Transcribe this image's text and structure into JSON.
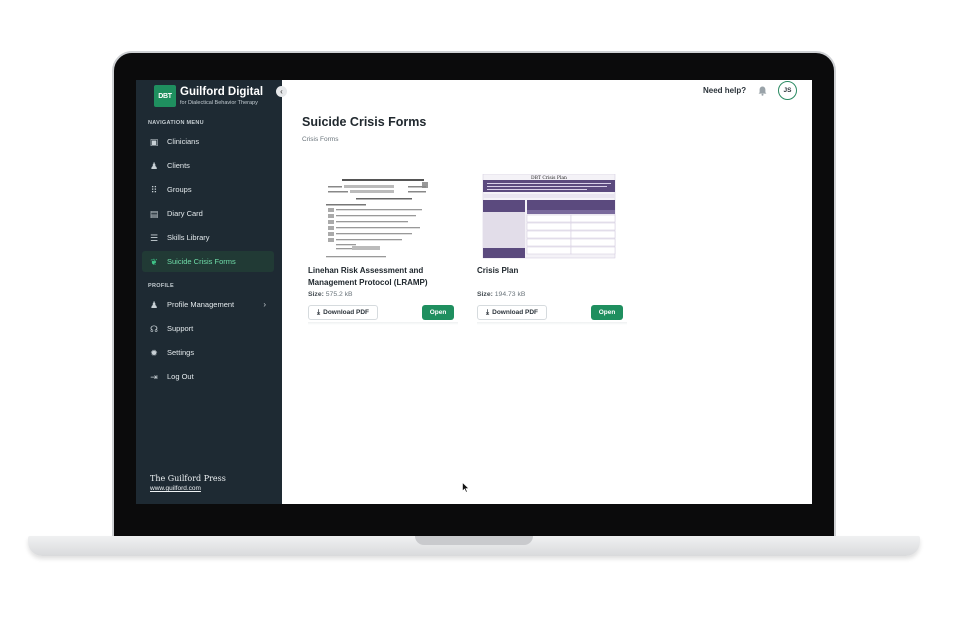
{
  "brand": {
    "logo_text": "DBT",
    "title": "Guilford Digital",
    "subtitle": "for Dialectical Behavior Therapy"
  },
  "sidebar": {
    "collapse_icon": "chevron-left-icon",
    "nav_section": "NAVIGATION MENU",
    "items": [
      {
        "label": "Clinicians",
        "icon": "id-card-icon",
        "glyph": "▣"
      },
      {
        "label": "Clients",
        "icon": "users-icon",
        "glyph": "♟"
      },
      {
        "label": "Groups",
        "icon": "grid-icon",
        "glyph": "⠿"
      },
      {
        "label": "Diary Card",
        "icon": "book-icon",
        "glyph": "▤"
      },
      {
        "label": "Skills Library",
        "icon": "list-icon",
        "glyph": "☰"
      },
      {
        "label": "Suicide Crisis Forms",
        "icon": "leaf-icon",
        "glyph": "❦",
        "active": true
      }
    ],
    "profile_section": "PROFILE",
    "profile_items": [
      {
        "label": "Profile Management",
        "icon": "user-icon",
        "glyph": "♟",
        "chevron": "›"
      },
      {
        "label": "Support",
        "icon": "headset-icon",
        "glyph": "☊"
      },
      {
        "label": "Settings",
        "icon": "gear-icon",
        "glyph": "✹"
      },
      {
        "label": "Log Out",
        "icon": "logout-icon",
        "glyph": "⇥"
      }
    ],
    "footer_press": "The Guilford Press",
    "footer_link": "www.guilford.com"
  },
  "header": {
    "help_label": "Need help?",
    "bell_icon": "bell-icon",
    "avatar_initials": "JS"
  },
  "main": {
    "title": "Suicide Crisis Forms",
    "breadcrumb": "Crisis Forms",
    "cards": [
      {
        "title": "Linehan Risk Assessment and Management Protocol (LRAMP)",
        "size_label": "Size:",
        "size_value": "575.2 kB",
        "download_label": "Download PDF",
        "open_label": "Open"
      },
      {
        "title": "Crisis Plan",
        "size_label": "Size:",
        "size_value": "194.73 kB",
        "download_label": "Download PDF",
        "open_label": "Open",
        "thumbnail_title": "DBT Crisis Plan"
      }
    ]
  },
  "colors": {
    "sidebar_bg": "#1e2a33",
    "accent_green": "#1f8f5f",
    "active_text": "#6fdca8",
    "crisis_plan_purple": "#5b4a7e"
  }
}
